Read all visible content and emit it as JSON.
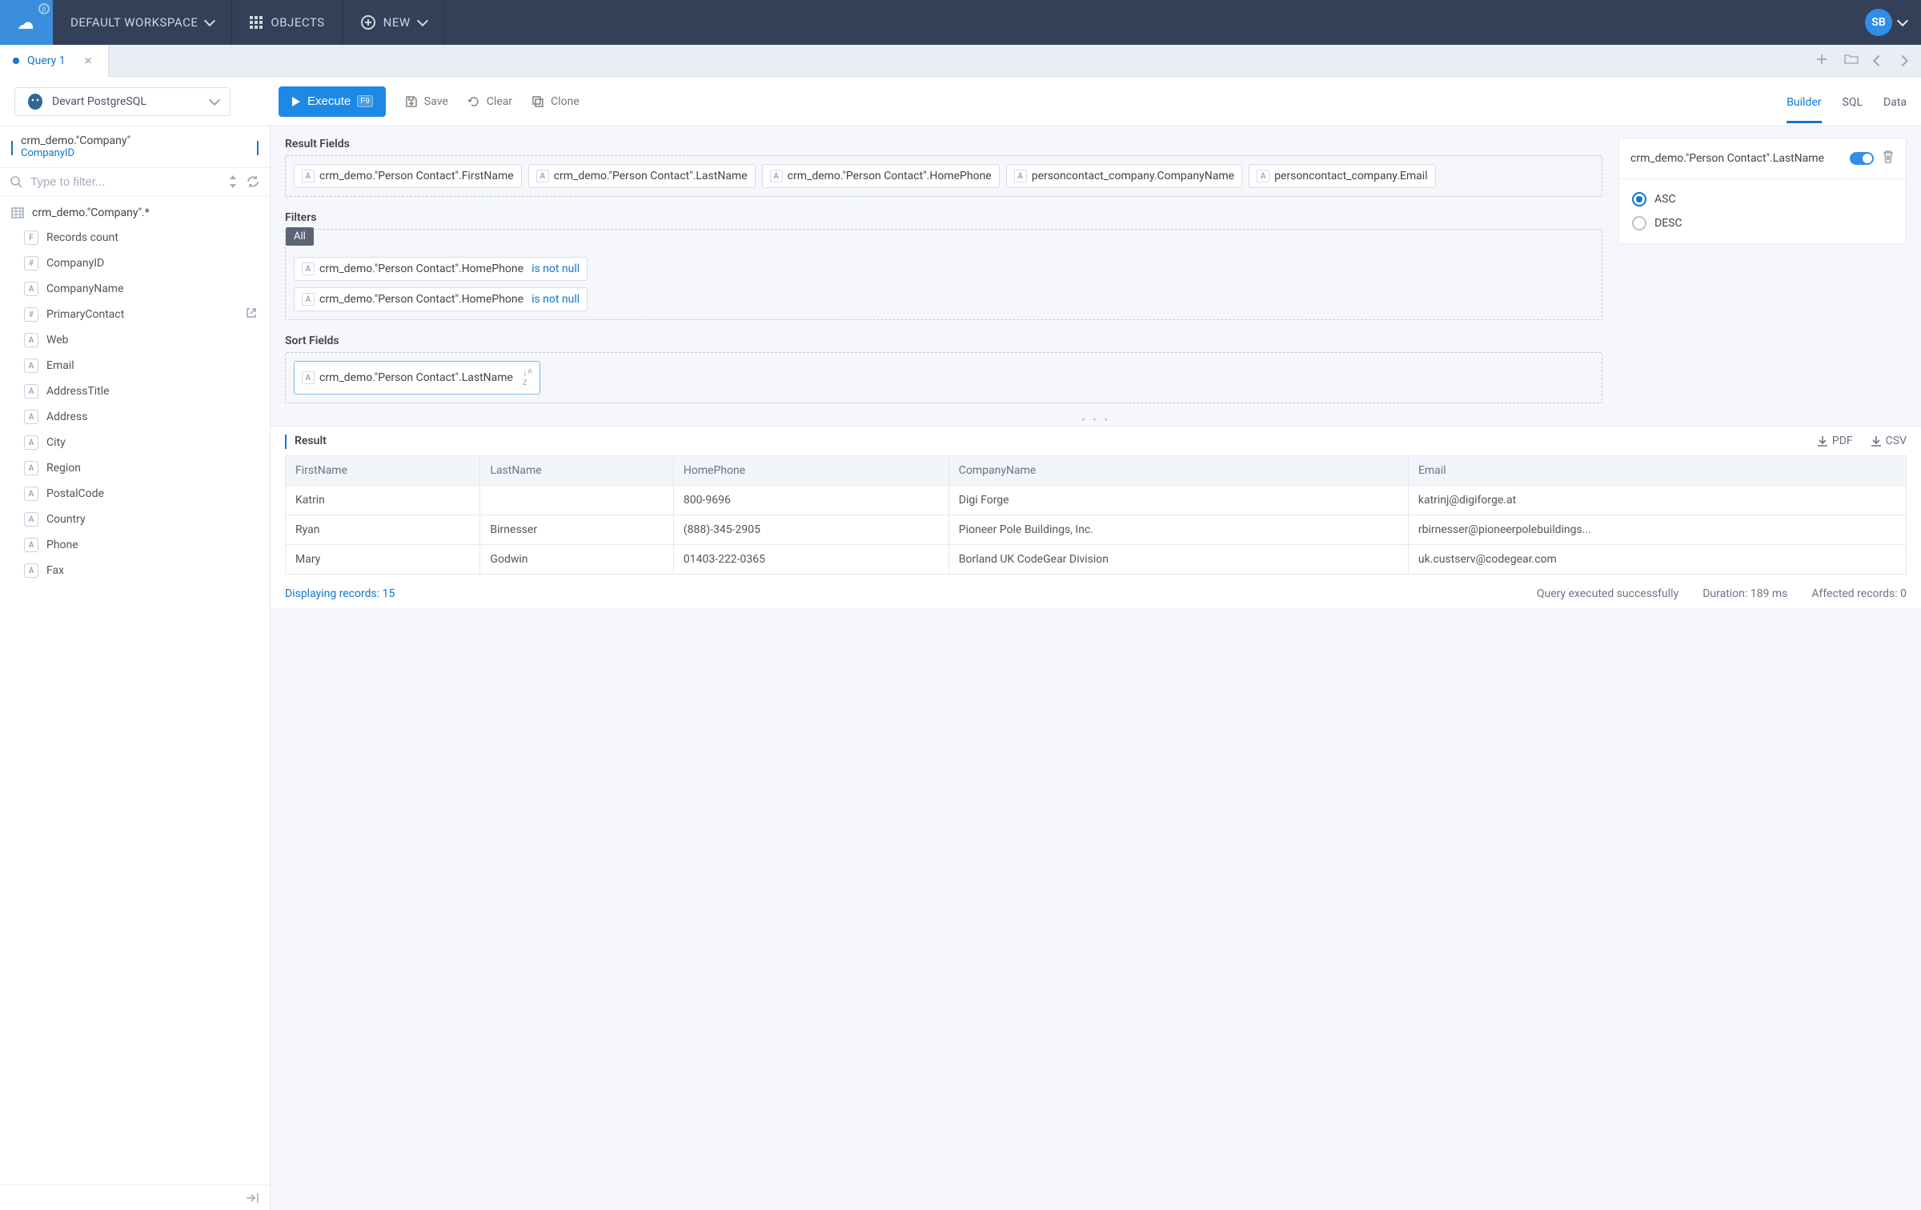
{
  "topnav": {
    "workspace_label": "DEFAULT WORKSPACE",
    "objects_label": "OBJECTS",
    "new_label": "NEW",
    "avatar_initials": "SB"
  },
  "tabs": {
    "items": [
      {
        "label": "Query 1",
        "dirty": true
      }
    ]
  },
  "connection": {
    "label": "Devart PostgreSQL"
  },
  "toolbar": {
    "execute_label": "Execute",
    "execute_kbd": "F9",
    "save_label": "Save",
    "clear_label": "Clear",
    "clone_label": "Clone"
  },
  "mode_tabs": {
    "builder": "Builder",
    "sql": "SQL",
    "data": "Data",
    "active": "builder"
  },
  "breadcrumb": {
    "title": "crm_demo.\"Company\"",
    "sub": "CompanyID"
  },
  "filter_placeholder": "Type to filter...",
  "tree": {
    "root": {
      "label": "crm_demo.\"Company\".*",
      "type": "table"
    },
    "children": [
      {
        "label": "Records count",
        "type": "F"
      },
      {
        "label": "CompanyID",
        "type": "#"
      },
      {
        "label": "CompanyName",
        "type": "A"
      },
      {
        "label": "PrimaryContact",
        "type": "#",
        "link": true
      },
      {
        "label": "Web",
        "type": "A"
      },
      {
        "label": "Email",
        "type": "A"
      },
      {
        "label": "AddressTitle",
        "type": "A"
      },
      {
        "label": "Address",
        "type": "A"
      },
      {
        "label": "City",
        "type": "A"
      },
      {
        "label": "Region",
        "type": "A"
      },
      {
        "label": "PostalCode",
        "type": "A"
      },
      {
        "label": "Country",
        "type": "A"
      },
      {
        "label": "Phone",
        "type": "A"
      },
      {
        "label": "Fax",
        "type": "A"
      }
    ]
  },
  "builder": {
    "result_fields_title": "Result Fields",
    "result_fields": [
      "crm_demo.\"Person Contact\".FirstName",
      "crm_demo.\"Person Contact\".LastName",
      "crm_demo.\"Person Contact\".HomePhone",
      "personcontact_company.CompanyName",
      "personcontact_company.Email"
    ],
    "filters_title": "Filters",
    "filters_mode": "All",
    "filters": [
      {
        "field": "crm_demo.\"Person Contact\".HomePhone",
        "cond": "is not null"
      },
      {
        "field": "crm_demo.\"Person Contact\".HomePhone",
        "cond": "is not null"
      }
    ],
    "sort_title": "Sort Fields",
    "sort_fields": [
      {
        "field": "crm_demo.\"Person Contact\".LastName",
        "dir": "asc"
      }
    ]
  },
  "props": {
    "title": "crm_demo.\"Person Contact\".LastName",
    "enabled": true,
    "dir": "ASC",
    "asc_label": "ASC",
    "desc_label": "DESC"
  },
  "result": {
    "title": "Result",
    "export_pdf": "PDF",
    "export_csv": "CSV",
    "columns": [
      "FirstName",
      "LastName",
      "HomePhone",
      "CompanyName",
      "Email"
    ],
    "rows": [
      [
        "Katrin",
        "",
        "800-9696",
        "Digi Forge",
        "katrinj@digiforge.at"
      ],
      [
        "Ryan",
        "Birnesser",
        "(888)-345-2905",
        "Pioneer Pole Buildings, Inc.",
        "rbirnesser@pioneerpolebuildings..."
      ],
      [
        "Mary",
        "Godwin",
        "01403-222-0365",
        "Borland UK CodeGear Division",
        "uk.custserv@codegear.com"
      ]
    ],
    "displaying": "Displaying records: 15",
    "success": "Query executed successfully",
    "duration": "Duration: 189 ms",
    "affected": "Affected records: 0"
  }
}
